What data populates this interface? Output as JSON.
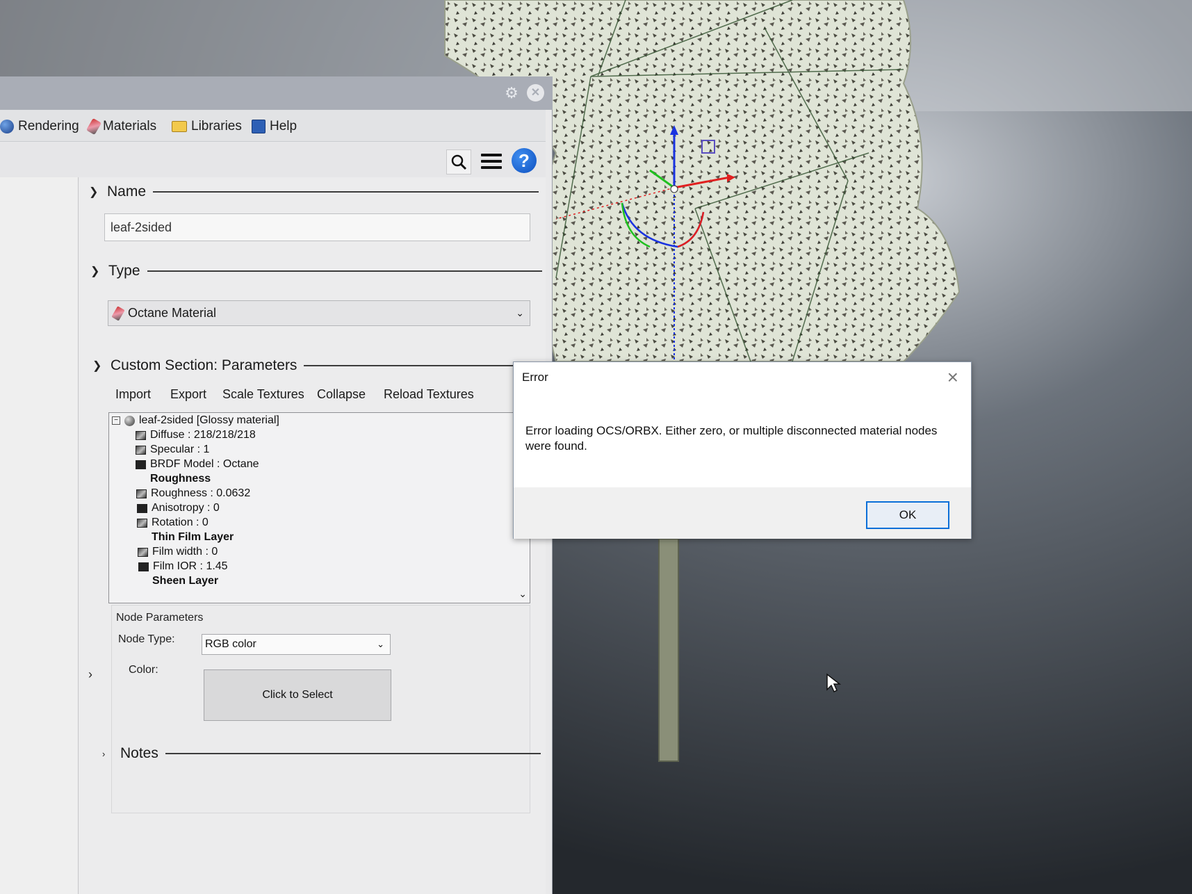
{
  "colors": {
    "accent": "#0b6fd8",
    "panel_bg": "#e9e9ea",
    "foliage": "#dfe4d6",
    "trunk": "#8a8f78",
    "axis_x": "#e02020",
    "axis_y": "#20c020",
    "axis_z": "#1a33e0"
  },
  "panel": {
    "tabs": [
      {
        "label": "Rendering",
        "icon": "rendering-icon"
      },
      {
        "label": "Materials",
        "icon": "materials-icon"
      },
      {
        "label": "Libraries",
        "icon": "folder-icon"
      },
      {
        "label": "Help",
        "icon": "help-book-icon"
      }
    ],
    "toolbar": {
      "icons": [
        "search-icon",
        "menu-icon",
        "help-icon"
      ],
      "help_glyph": "?"
    },
    "name_section": {
      "title": "Name",
      "value": "leaf-2sided"
    },
    "type_section": {
      "title": "Type",
      "value": "Octane Material"
    },
    "custom_section": {
      "title": "Custom Section: Parameters",
      "commands": [
        "Import",
        "Export",
        "Scale Textures",
        "Collapse",
        "Reload Textures"
      ],
      "tree": [
        {
          "text": "leaf-2sided  [Glossy material]",
          "kind": "root"
        },
        {
          "text": "Diffuse : 218/218/218",
          "kind": "node"
        },
        {
          "text": "Specular : 1",
          "kind": "node"
        },
        {
          "text": "BRDF Model : Octane",
          "kind": "node"
        },
        {
          "text": "Roughness",
          "kind": "group"
        },
        {
          "text": "Roughness : 0.0632",
          "kind": "node"
        },
        {
          "text": "Anisotropy : 0",
          "kind": "node"
        },
        {
          "text": "Rotation : 0",
          "kind": "node"
        },
        {
          "text": "Thin Film Layer",
          "kind": "group"
        },
        {
          "text": "Film width : 0",
          "kind": "node"
        },
        {
          "text": "Film IOR : 1.45",
          "kind": "node"
        },
        {
          "text": "Sheen Layer",
          "kind": "group"
        }
      ]
    },
    "node_params": {
      "title": "Node Parameters",
      "node_type_label": "Node Type:",
      "node_type_value": "RGB color",
      "color_label": "Color:",
      "color_button": "Click to Select"
    },
    "notes_section": {
      "title": "Notes"
    }
  },
  "dialog": {
    "title": "Error",
    "message": "Error loading OCS/ORBX.  Either zero, or multiple disconnected material nodes were found.",
    "ok_label": "OK",
    "close_glyph": "×"
  }
}
